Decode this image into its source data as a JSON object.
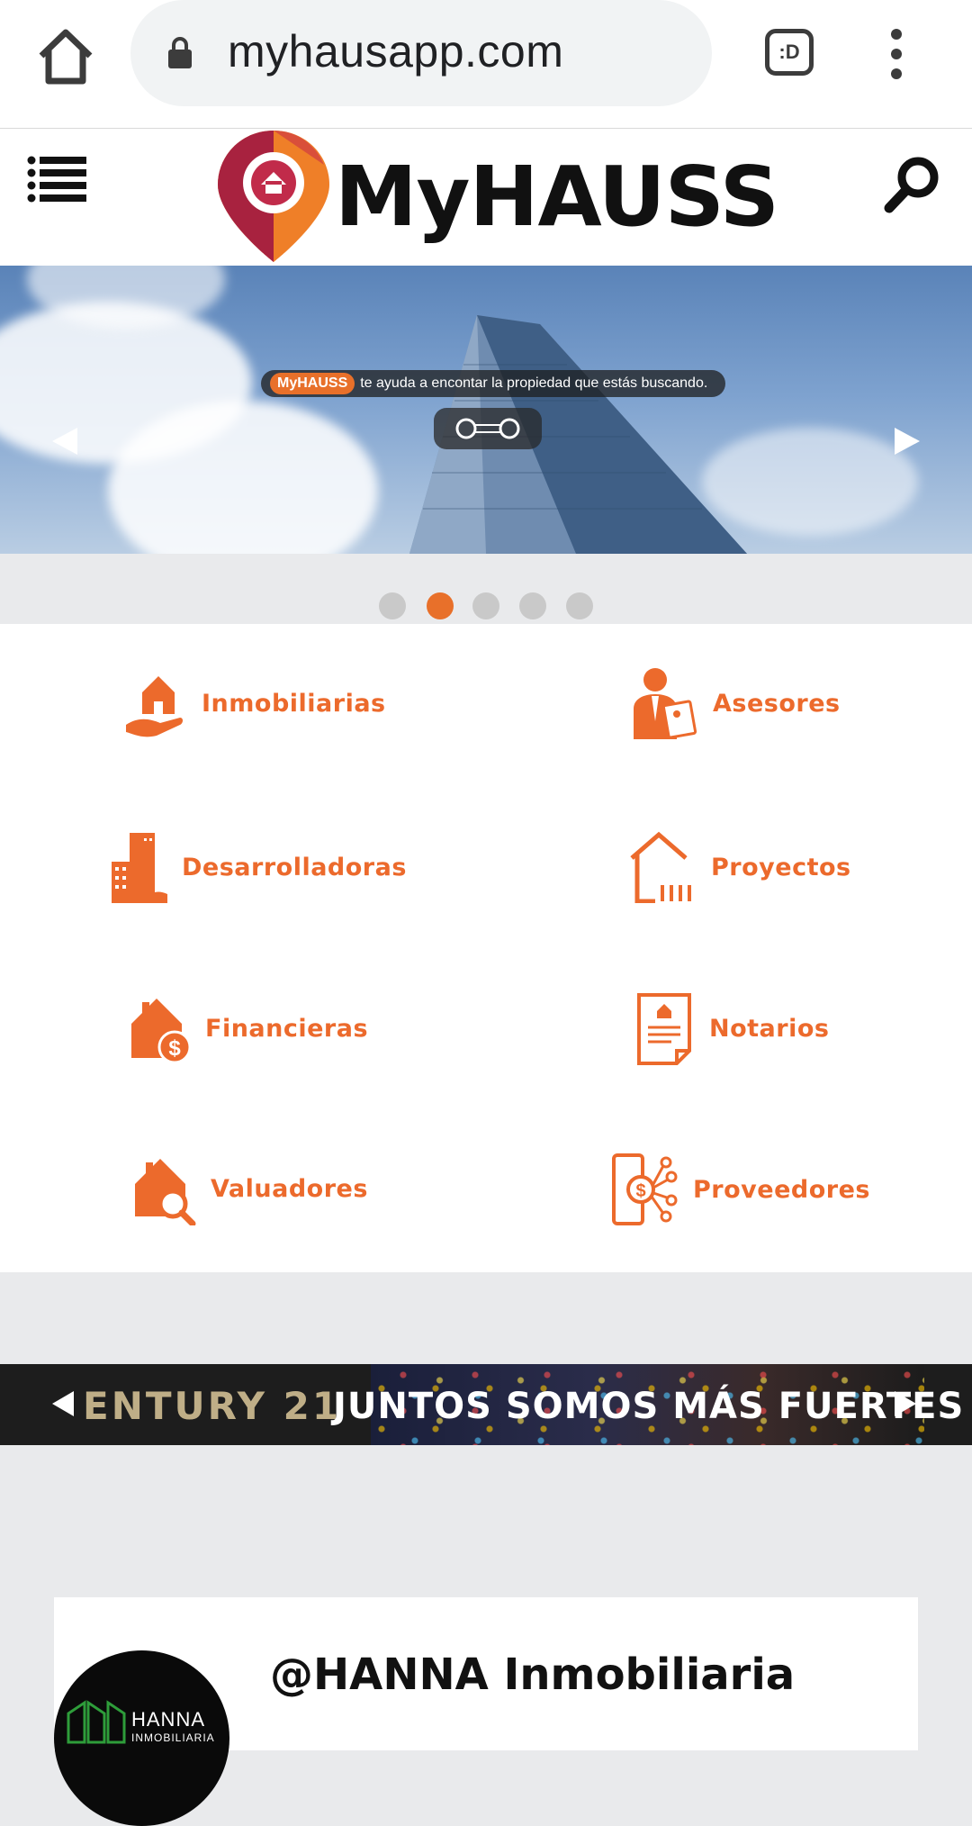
{
  "browser": {
    "url": "myhausapp.com",
    "tab_label": ":D"
  },
  "site": {
    "brand": "MyHAUSS",
    "accent_color": "#ec6a2c",
    "pin_colors": [
      "#a8223f",
      "#ef7f28"
    ]
  },
  "hero": {
    "caption_brand": "MyHAUSS",
    "caption_text": "te ayuda a encontar la propiedad que estás buscando.",
    "slide_count": 5,
    "active_slide": 2
  },
  "categories": [
    {
      "label": "Inmobiliarias",
      "icon": "house-in-hand-icon"
    },
    {
      "label": "Asesores",
      "icon": "advisor-icon"
    },
    {
      "label": "Desarrolladoras",
      "icon": "buildings-icon"
    },
    {
      "label": "Proyectos",
      "icon": "project-house-icon"
    },
    {
      "label": "Financieras",
      "icon": "house-money-icon"
    },
    {
      "label": "Notarios",
      "icon": "document-icon"
    },
    {
      "label": "Valuadores",
      "icon": "house-search-icon"
    },
    {
      "label": "Proveedores",
      "icon": "phone-money-network-icon"
    }
  ],
  "banner": {
    "brand": "ENTURY 21",
    "tagline": "JUNTOS SOMOS MÁS FUERTES"
  },
  "profile": {
    "handle": "@HANNA Inmobiliaria",
    "avatar_name": "HANNA",
    "avatar_sub": "INMOBILIARIA"
  }
}
